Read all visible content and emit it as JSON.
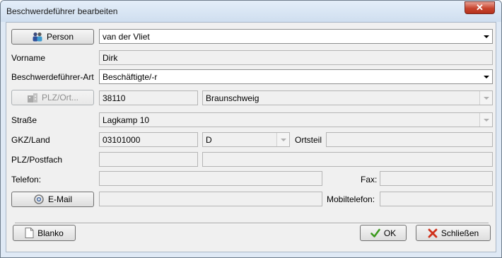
{
  "window": {
    "title": "Beschwerdeführer bearbeiten",
    "close_symbol": "✕"
  },
  "person": {
    "button_label": "Person",
    "value": "van der Vliet"
  },
  "vorname": {
    "label": "Vorname",
    "value": "Dirk"
  },
  "art": {
    "label": "Beschwerdeführer-Art",
    "value": "Beschäftigte/-r"
  },
  "plz_ort": {
    "button_label": "PLZ/Ort...",
    "plz": "38110",
    "ort": "Braunschweig"
  },
  "strasse": {
    "label": "Straße",
    "value": "Lagkamp 10"
  },
  "gkz": {
    "label": "GKZ/Land",
    "value": "03101000",
    "land": "D",
    "ortsteil_label": "Ortsteil",
    "ortsteil_value": ""
  },
  "postfach": {
    "label": "PLZ/Postfach",
    "plz": "",
    "postfach": ""
  },
  "telefon": {
    "label": "Telefon:",
    "value": "",
    "fax_label": "Fax:",
    "fax_value": ""
  },
  "email": {
    "button_label": "E-Mail",
    "value": "",
    "mobil_label": "Mobiltelefon:",
    "mobil_value": ""
  },
  "footer": {
    "blanko_label": "Blanko",
    "ok_label": "OK",
    "close_label": "Schließen"
  },
  "colors": {
    "ok_check": "#3c9a1e",
    "close_x": "#d0311b",
    "title_bar": "#d6e4f3",
    "dialog_bg": "#f0f0f0"
  }
}
